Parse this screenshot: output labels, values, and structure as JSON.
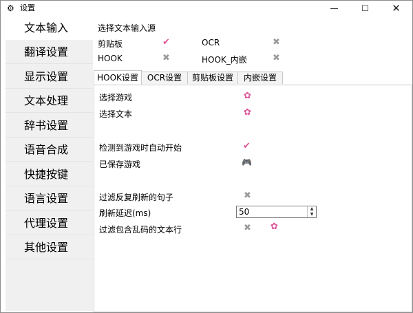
{
  "window": {
    "title": "设置",
    "icon": "gear-icon",
    "controls": {
      "minimize": "—",
      "maximize": "☐",
      "close": "✕"
    }
  },
  "sidebar": {
    "items": [
      {
        "label": "文本输入",
        "active": true
      },
      {
        "label": "翻译设置"
      },
      {
        "label": "显示设置"
      },
      {
        "label": "文本处理"
      },
      {
        "label": "辞书设置"
      },
      {
        "label": "语音合成"
      },
      {
        "label": "快捷按键"
      },
      {
        "label": "语言设置"
      },
      {
        "label": "代理设置"
      },
      {
        "label": "其他设置"
      }
    ]
  },
  "source": {
    "title": "选择文本输入源",
    "options": [
      {
        "label": "剪贴板",
        "state": "enabled",
        "glyph": "✔"
      },
      {
        "label": "OCR",
        "state": "disabled",
        "glyph": "✖"
      },
      {
        "label": "HOOK",
        "state": "disabled",
        "glyph": "✖"
      },
      {
        "label": "HOOK_内嵌",
        "state": "disabled",
        "glyph": "✖"
      }
    ]
  },
  "tabs": [
    {
      "label": "HOOK设置",
      "active": true
    },
    {
      "label": "OCR设置"
    },
    {
      "label": "剪贴板设置"
    },
    {
      "label": "内嵌设置"
    }
  ],
  "hook": {
    "select_game": {
      "label": "选择游戏",
      "glyph": "✿"
    },
    "select_text": {
      "label": "选择文本",
      "glyph": "✿"
    },
    "auto_start": {
      "label": "检测到游戏时自动开始",
      "glyph": "✔"
    },
    "saved_games": {
      "label": "已保存游戏",
      "glyph": "🎮"
    },
    "filter_repeat": {
      "label": "过滤反复刷新的句子",
      "glyph": "✖"
    },
    "refresh_delay": {
      "label": "刷新延迟(ms)",
      "value": "50",
      "up": "▲",
      "down": "▼"
    },
    "filter_garbled": {
      "label": "过滤包含乱码的文本行",
      "toggle_glyph": "✖",
      "settings_glyph": "✿"
    }
  },
  "colors": {
    "accent": "#e0529a",
    "disabled": "#9a9a9a",
    "sidebar_bg": "#f0f0f0"
  }
}
